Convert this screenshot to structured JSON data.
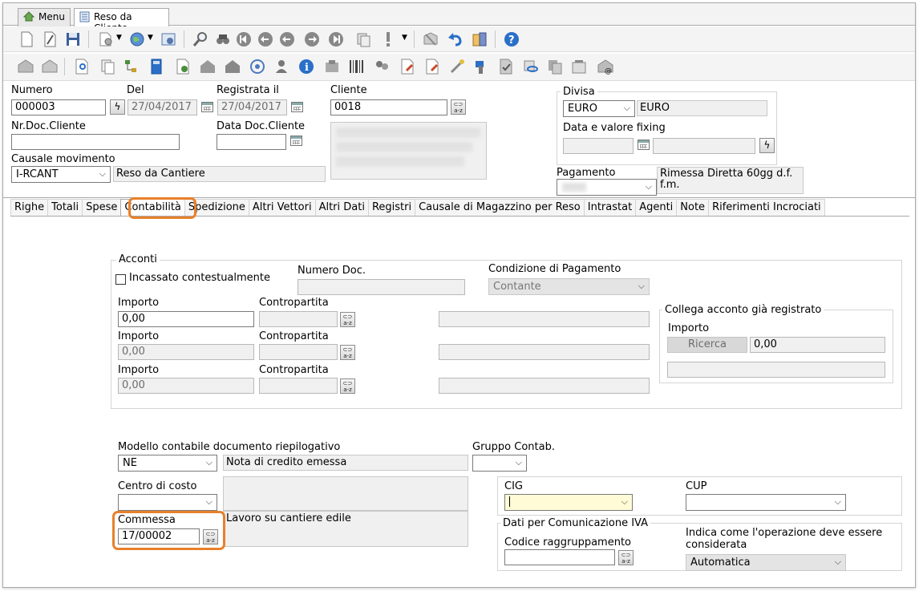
{
  "tabs": [
    {
      "label": "Menu"
    },
    {
      "label": "Reso da Cliente"
    }
  ],
  "header": {
    "numero_label": "Numero",
    "numero_value": "000003",
    "del_label": "Del",
    "del_value": "27/04/2017",
    "registrata_label": "Registrata il",
    "registrata_value": "27/04/2017",
    "cliente_label": "Cliente",
    "cliente_value": "0018",
    "nrdoc_label": "Nr.Doc.Cliente",
    "nrdoc_value": "",
    "datadoc_label": "Data Doc.Cliente",
    "datadoc_value": "",
    "causale_label": "Causale movimento",
    "causale_value": "I-RCANT",
    "causale_desc": "Reso da Cantiere",
    "divisa_label": "Divisa",
    "divisa_value": "EURO",
    "divisa_desc": "EURO",
    "fixing_label": "Data e valore fixing",
    "pagamento_label": "Pagamento",
    "pagamento_desc": "Rimessa Diretta 60gg d.f. f.m."
  },
  "subtabs": [
    "Righe",
    "Totali",
    "Spese",
    "Contabilità",
    "Spedizione",
    "Altri Vettori",
    "Altri Dati",
    "Registri",
    "Causale di Magazzino per Reso",
    "Intrastat",
    "Agenti",
    "Note",
    "Riferimenti Incrociati"
  ],
  "acconti": {
    "title": "Acconti",
    "incassato_label": "Incassato contestualmente",
    "numero_doc_label": "Numero Doc.",
    "condizione_label": "Condizione di Pagamento",
    "condizione_value": "Contante",
    "importo_label": "Importo",
    "contropartita_label": "Contropartita",
    "importo1": "0,00",
    "importo2": "0,00",
    "importo3": "0,00",
    "collega_title": "Collega acconto già registrato",
    "collega_importo_label": "Importo",
    "ricerca_label": "Ricerca",
    "collega_importo_value": "0,00"
  },
  "contab": {
    "modello_label": "Modello contabile documento riepilogativo",
    "modello_value": "NE",
    "modello_desc": "Nota di credito emessa",
    "gruppo_label": "Gruppo Contab.",
    "centro_label": "Centro di costo",
    "commessa_label": "Commessa",
    "commessa_value": "17/00002",
    "commessa_desc": "Lavoro su cantiere edile",
    "cig_label": "CIG",
    "cup_label": "CUP",
    "iva_title": "Dati per Comunicazione IVA",
    "codice_label": "Codice raggruppamento",
    "indica_label": "Indica come l'operazione deve essere considerata",
    "indica_value": "Automatica"
  },
  "glyphs": {
    "az_top": "⊂⊃",
    "az_bottom": "a-z",
    "chevron": "⌵",
    "bolt": "ϟ"
  },
  "colors": {
    "highlight": "#e8802a",
    "cig_field": "#fffbd6"
  }
}
